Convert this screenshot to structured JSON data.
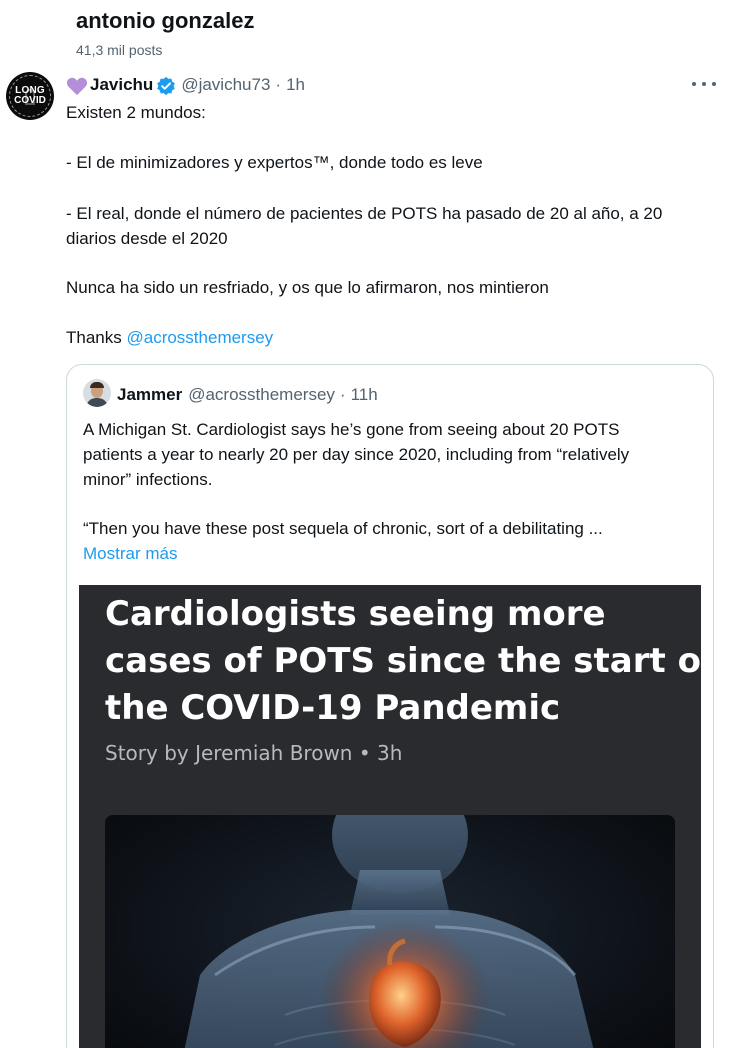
{
  "header": {
    "name": "antonio gonzalez",
    "post_count": "41,3 mil posts"
  },
  "tweet": {
    "author": "Javichu",
    "handle": "@javichu73",
    "separator": "·",
    "time": "1h",
    "avatar_text_line1": "LONG",
    "avatar_text_line2": "COVID",
    "lines": [
      "Existen 2 mundos:",
      "-  El de minimizadores y expertos™, donde todo es leve",
      "- El real, donde el número de pacientes de POTS ha pasado de 20 al año, a 20",
      "diarios desde el 2020",
      "Nunca ha sido un resfriado, y os que lo afirmaron, nos mintieron"
    ],
    "thanks_prefix": "Thanks ",
    "thanks_mention": "@acrossthemersey"
  },
  "quote": {
    "author": "Jammer",
    "handle": "@acrossthemersey",
    "separator": "·",
    "time": "11h",
    "lines": [
      "A Michigan St. Cardiologist says he’s gone from seeing about 20 POTS",
      "patients a year to nearly 20 per day since 2020, including from “relatively",
      "minor” infections.",
      "“Then you have these post sequela of chronic, sort of a debilitating ..."
    ],
    "show_more": "Mostrar más",
    "article": {
      "title_lines": [
        "Cardiologists seeing more",
        "cases of POTS since the start of",
        "the COVID-19 Pandemic"
      ],
      "byline": "Story by Jeremiah Brown • 3h"
    }
  },
  "colors": {
    "link": "#1d9bf0",
    "secondary_text": "#536471",
    "verified_badge": "#1d9bf0",
    "heart": "#b48ed8"
  }
}
